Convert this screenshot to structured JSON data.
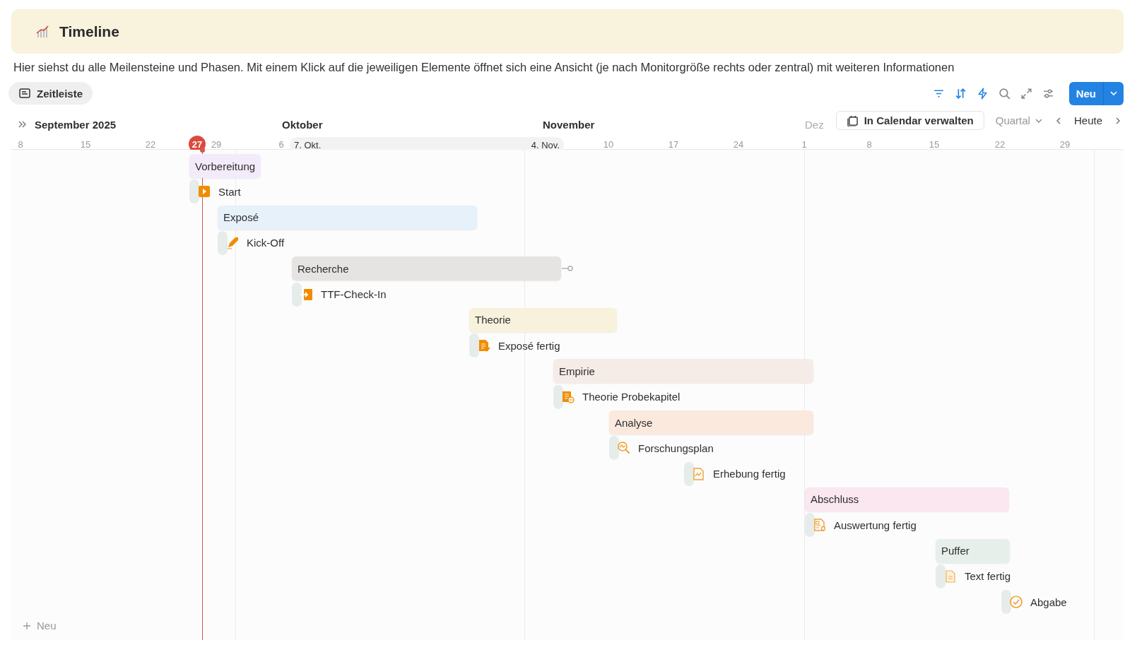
{
  "page": {
    "title": "Timeline",
    "description": "Hier siehst du alle Meilensteine und Phasen. Mit einem Klick auf die jeweiligen Elemente öffnet sich eine Ansicht (je nach Monitorgröße rechts oder zentral) mit weiteren Informationen"
  },
  "view_tab": {
    "label": "Zeitleiste",
    "selected": true
  },
  "toolbar": {
    "new_button": "Neu"
  },
  "timeline": {
    "months": [
      "September 2025",
      "Oktober",
      "November",
      "Dez"
    ],
    "days": [
      {
        "label": "8",
        "today": false
      },
      {
        "label": "15",
        "today": false
      },
      {
        "label": "22",
        "today": false
      },
      {
        "label": "27",
        "today": true
      },
      {
        "label": "29",
        "today": false
      },
      {
        "label": "6",
        "today": false
      },
      {
        "label": "10",
        "today": false
      },
      {
        "label": "17",
        "today": false
      },
      {
        "label": "24",
        "today": false
      },
      {
        "label": "1",
        "today": false
      },
      {
        "label": "8",
        "today": false
      },
      {
        "label": "15",
        "today": false
      },
      {
        "label": "22",
        "today": false
      },
      {
        "label": "29",
        "today": false
      }
    ],
    "range_pill": {
      "start": "7. Okt.",
      "end": "4. Nov."
    },
    "calendar_button": "In Calendar verwalten",
    "scale": "Quartal",
    "today_button": "Heute",
    "items": [
      {
        "kind": "phase",
        "title": "Vorbereitung",
        "color": "#f3ebf9"
      },
      {
        "kind": "milestone",
        "title": "Start"
      },
      {
        "kind": "phase",
        "title": "Exposé",
        "color": "#e7f1fa"
      },
      {
        "kind": "milestone",
        "title": "Kick-Off"
      },
      {
        "kind": "phase",
        "title": "Recherche",
        "color": "#e5e4e2"
      },
      {
        "kind": "milestone",
        "title": "TTF-Check-In"
      },
      {
        "kind": "phase",
        "title": "Theorie",
        "color": "#f8f2dc"
      },
      {
        "kind": "milestone",
        "title": "Exposé fertig"
      },
      {
        "kind": "phase",
        "title": "Empirie",
        "color": "#f5ece8"
      },
      {
        "kind": "milestone",
        "title": "Theorie Probekapitel"
      },
      {
        "kind": "phase",
        "title": "Analyse",
        "color": "#fbe9de"
      },
      {
        "kind": "milestone",
        "title": "Forschungsplan"
      },
      {
        "kind": "milestone",
        "title": "Erhebung fertig"
      },
      {
        "kind": "phase",
        "title": "Abschluss",
        "color": "#fae7ef"
      },
      {
        "kind": "milestone",
        "title": "Auswertung fertig"
      },
      {
        "kind": "phase",
        "title": "Puffer",
        "color": "#e7efeb"
      },
      {
        "kind": "milestone",
        "title": "Text fertig"
      },
      {
        "kind": "milestone",
        "title": "Abgabe"
      }
    ],
    "add_button": "Neu"
  }
}
